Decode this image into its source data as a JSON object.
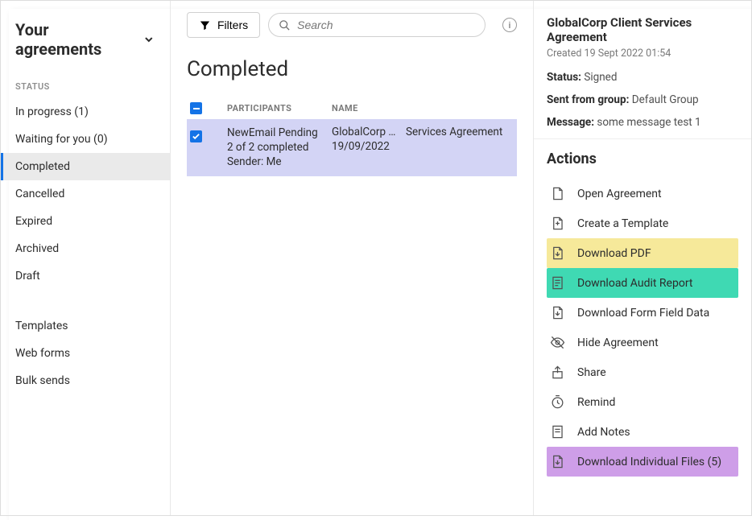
{
  "sidebar": {
    "title": "Your agreements",
    "status_label": "STATUS",
    "items": [
      {
        "label": "In progress (1)"
      },
      {
        "label": "Waiting for you (0)"
      },
      {
        "label": "Completed"
      },
      {
        "label": "Cancelled"
      },
      {
        "label": "Expired"
      },
      {
        "label": "Archived"
      },
      {
        "label": "Draft"
      }
    ],
    "group2": [
      {
        "label": "Templates"
      },
      {
        "label": "Web forms"
      },
      {
        "label": "Bulk sends"
      }
    ]
  },
  "toolbar": {
    "filters_label": "Filters",
    "search_placeholder": "Search"
  },
  "main": {
    "heading": "Completed",
    "columns": {
      "participants": "PARTICIPANTS",
      "name": "NAME"
    },
    "row": {
      "participant_line1": "NewEmail Pending",
      "participant_line2": "2 of 2 completed",
      "participant_line3": "Sender: Me",
      "name_part1": "GlobalCorp Client",
      "name_part2": "Services Agreement",
      "date": "19/09/2022"
    }
  },
  "details": {
    "title": "GlobalCorp Client Services Agreement",
    "created": "Created 19 Sept 2022 01:54",
    "status_label": "Status:",
    "status_value": "Signed",
    "group_label": "Sent from group:",
    "group_value": "Default Group",
    "message_label": "Message:",
    "message_value": "some message test 1",
    "actions_title": "Actions",
    "actions": [
      {
        "label": "Open Agreement"
      },
      {
        "label": "Create a Template"
      },
      {
        "label": "Download PDF"
      },
      {
        "label": "Download Audit Report"
      },
      {
        "label": "Download Form Field Data"
      },
      {
        "label": "Hide Agreement"
      },
      {
        "label": "Share"
      },
      {
        "label": "Remind"
      },
      {
        "label": "Add Notes"
      },
      {
        "label": "Download Individual Files (5)"
      }
    ]
  }
}
